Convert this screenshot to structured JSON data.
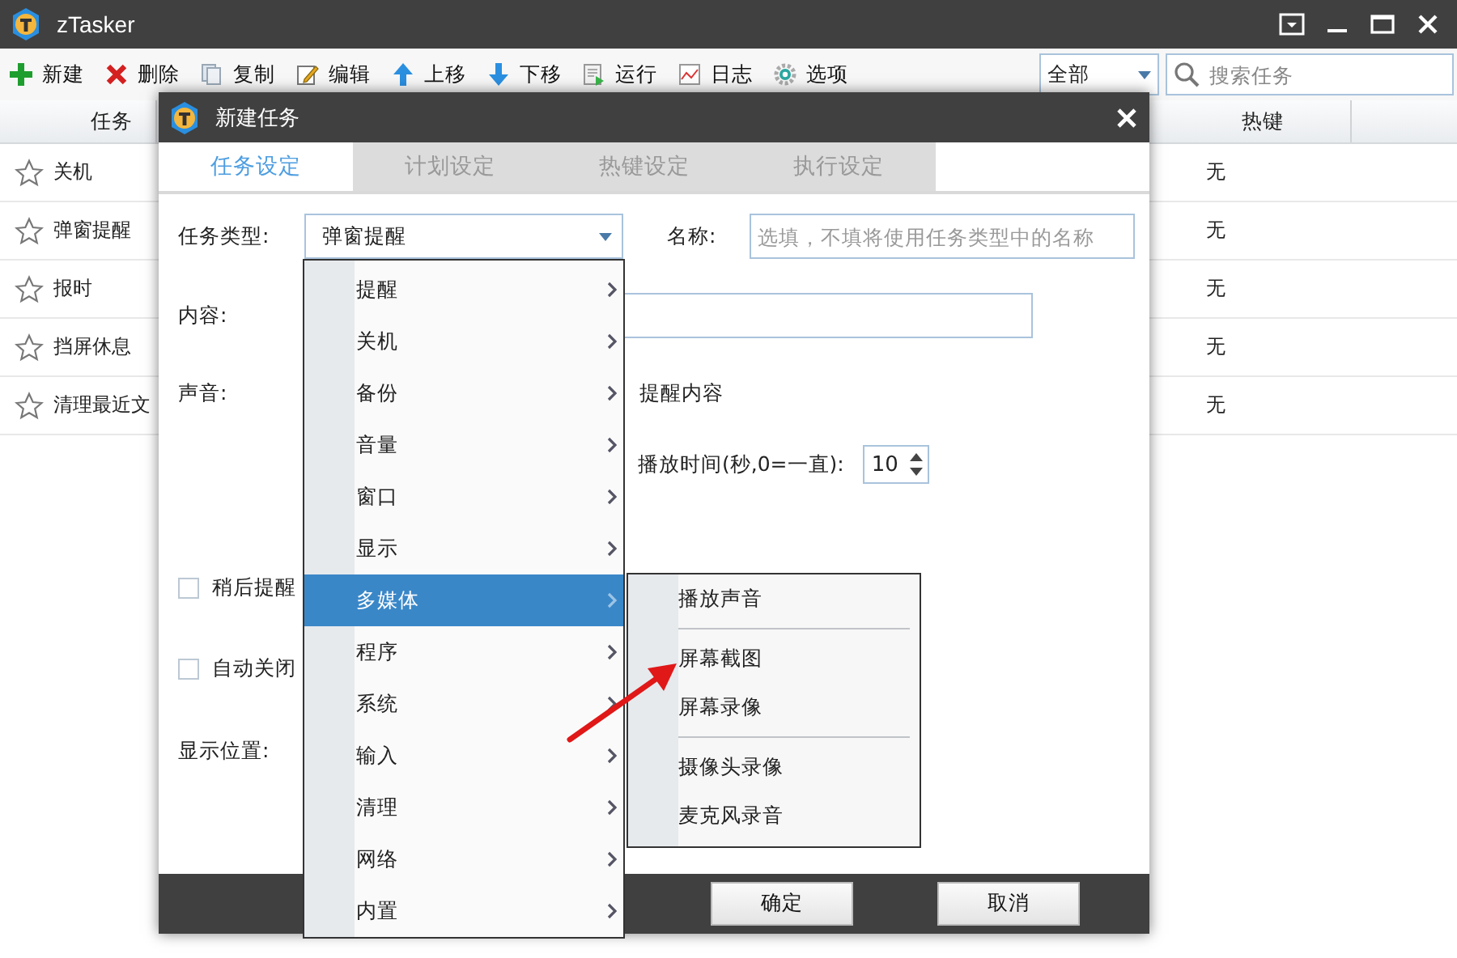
{
  "window": {
    "title": "zTasker"
  },
  "toolbar": [
    {
      "label": "新建"
    },
    {
      "label": "删除"
    },
    {
      "label": "复制"
    },
    {
      "label": "编辑"
    },
    {
      "label": "上移"
    },
    {
      "label": "下移"
    },
    {
      "label": "运行"
    },
    {
      "label": "日志"
    },
    {
      "label": "选项"
    }
  ],
  "filter": {
    "value": "全部"
  },
  "search": {
    "placeholder": "搜索任务"
  },
  "table": {
    "columns": [
      "任务",
      "热键"
    ],
    "rows": [
      {
        "task": "关机",
        "hotkey": "无"
      },
      {
        "task": "弹窗提醒",
        "hotkey": "无"
      },
      {
        "task": "报时",
        "hotkey": "无"
      },
      {
        "task": "挡屏休息",
        "hotkey": "无"
      },
      {
        "task": "清理最近文",
        "hotkey": "无"
      }
    ]
  },
  "dialog": {
    "title": "新建任务",
    "tabs": [
      {
        "label": "任务设定",
        "selected": true
      },
      {
        "label": "计划设定",
        "selected": false
      },
      {
        "label": "热键设定",
        "selected": false
      },
      {
        "label": "执行设定",
        "selected": false
      }
    ],
    "task_type": {
      "label": "任务类型:",
      "value": "弹窗提醒"
    },
    "name": {
      "label": "名称:",
      "placeholder": "选填，不填将使用任务类型中的名称"
    },
    "content": {
      "label": "内容:"
    },
    "sound": {
      "label": "声音:",
      "option_text": "提醒内容"
    },
    "play_time": {
      "label": "播放时间(秒,0=一直):",
      "value": "10"
    },
    "remind_later": {
      "label": "稍后提醒",
      "checked": false
    },
    "auto_close": {
      "label": "自动关闭",
      "checked": false
    },
    "position": {
      "label": "显示位置:"
    },
    "buttons": [
      "确定",
      "取消"
    ]
  },
  "type_menu": [
    {
      "label": "提醒",
      "selected": false
    },
    {
      "label": "关机",
      "selected": false
    },
    {
      "label": "备份",
      "selected": false
    },
    {
      "label": "音量",
      "selected": false
    },
    {
      "label": "窗口",
      "selected": false
    },
    {
      "label": "显示",
      "selected": false
    },
    {
      "label": "多媒体",
      "selected": true
    },
    {
      "label": "程序",
      "selected": false
    },
    {
      "label": "系统",
      "selected": false
    },
    {
      "label": "输入",
      "selected": false
    },
    {
      "label": "清理",
      "selected": false
    },
    {
      "label": "网络",
      "selected": false
    },
    {
      "label": "内置",
      "selected": false
    }
  ],
  "submenu": [
    {
      "kind": "item",
      "label": "播放声音"
    },
    {
      "kind": "separator"
    },
    {
      "kind": "item",
      "label": "屏幕截图"
    },
    {
      "kind": "item",
      "label": "屏幕录像"
    },
    {
      "kind": "separator"
    },
    {
      "kind": "item",
      "label": "摄像头录像"
    },
    {
      "kind": "item",
      "label": "麦克风录音"
    }
  ]
}
